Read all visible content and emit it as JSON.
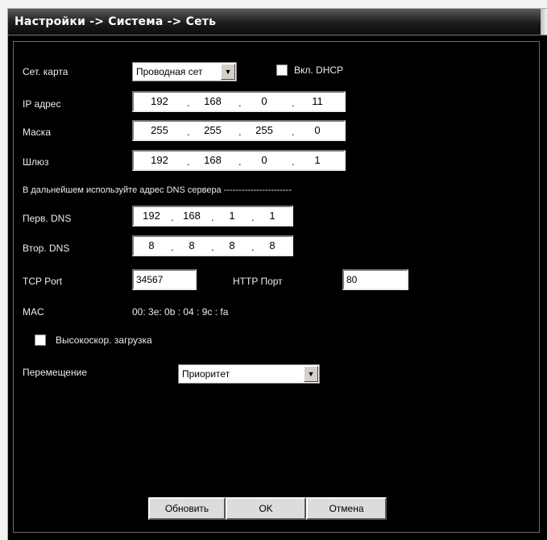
{
  "window": {
    "title": "Настройки -> Система -> Сеть"
  },
  "network_card": {
    "label": "Сет. карта",
    "value": "Проводная сет"
  },
  "dhcp": {
    "label": "Вкл. DHCP",
    "checked": false
  },
  "ip_address": {
    "label": "IP адрес",
    "octets": [
      "192",
      "168",
      "0",
      "11"
    ]
  },
  "mask": {
    "label": "Маска",
    "octets": [
      "255",
      "255",
      "255",
      "0"
    ]
  },
  "gateway": {
    "label": "Шлюз",
    "octets": [
      "192",
      "168",
      "0",
      "1"
    ]
  },
  "dns_hint": "В дальнейшем используйте адрес DNS сервера -----------------------",
  "primary_dns": {
    "label": "Перв. DNS",
    "octets": [
      "192",
      "168",
      "1",
      "1"
    ]
  },
  "secondary_dns": {
    "label": "Втор. DNS",
    "octets": [
      "8",
      "8",
      "8",
      "8"
    ]
  },
  "tcp_port": {
    "label": "TCP Port",
    "value": "34567"
  },
  "http_port": {
    "label": "HTTP Порт",
    "value": "80"
  },
  "mac": {
    "label": "MAC",
    "value": "00: 3e: 0b : 04 : 9c : fa"
  },
  "high_speed_download": {
    "label": "Высокоскор. загрузка",
    "checked": false
  },
  "transfer": {
    "label": "Перемещение",
    "value": "Приоритет"
  },
  "buttons": {
    "refresh": "Обновить",
    "ok": "OK",
    "cancel": "Отмена"
  },
  "icons": {
    "dropdown": "triangle-down-icon"
  },
  "colors": {
    "background": "#000000",
    "text": "#ececec",
    "titlebar": "#1c1c1c"
  }
}
